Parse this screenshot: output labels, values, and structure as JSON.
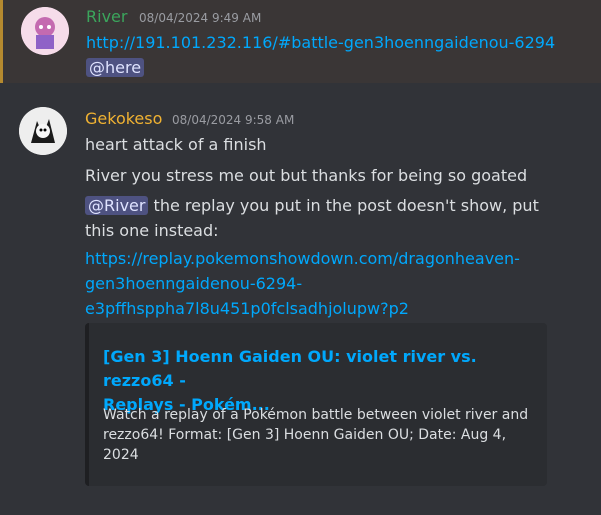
{
  "messages": [
    {
      "username": "River",
      "username_color": "#3ba55c",
      "timestamp": "08/04/2024 9:49 AM",
      "link": "http://191.101.232.116/#battle-gen3hoenngaidenou-6294",
      "mention": "@here"
    },
    {
      "username": "Gekokeso",
      "username_color": "#f0b232",
      "timestamp": "08/04/2024 9:58 AM",
      "line1": "heart attack of a finish",
      "line2": "River you stress me out but thanks for being so goated",
      "mention": "@River",
      "line3_rest": "the replay you put in the post doesn't show, put",
      "line4": "this one instead:",
      "link_lines": [
        "https://replay.pokemonshowdown.com/dragonheaven-",
        "gen3hoenngaidenou-6294-",
        "e3pffhsppha7l8u451p0fclsadhjolupw?p2"
      ],
      "embed": {
        "title_lines": [
          "[Gen 3] Hoenn Gaiden OU: violet river vs. rezzo64 -",
          "Replays - Pokém..."
        ],
        "description_lines": [
          "Watch a replay of a Pokémon battle between violet river and",
          "rezzo64! Format: [Gen 3] Hoenn Gaiden OU; Date: Aug 4,",
          "2024"
        ]
      }
    }
  ]
}
